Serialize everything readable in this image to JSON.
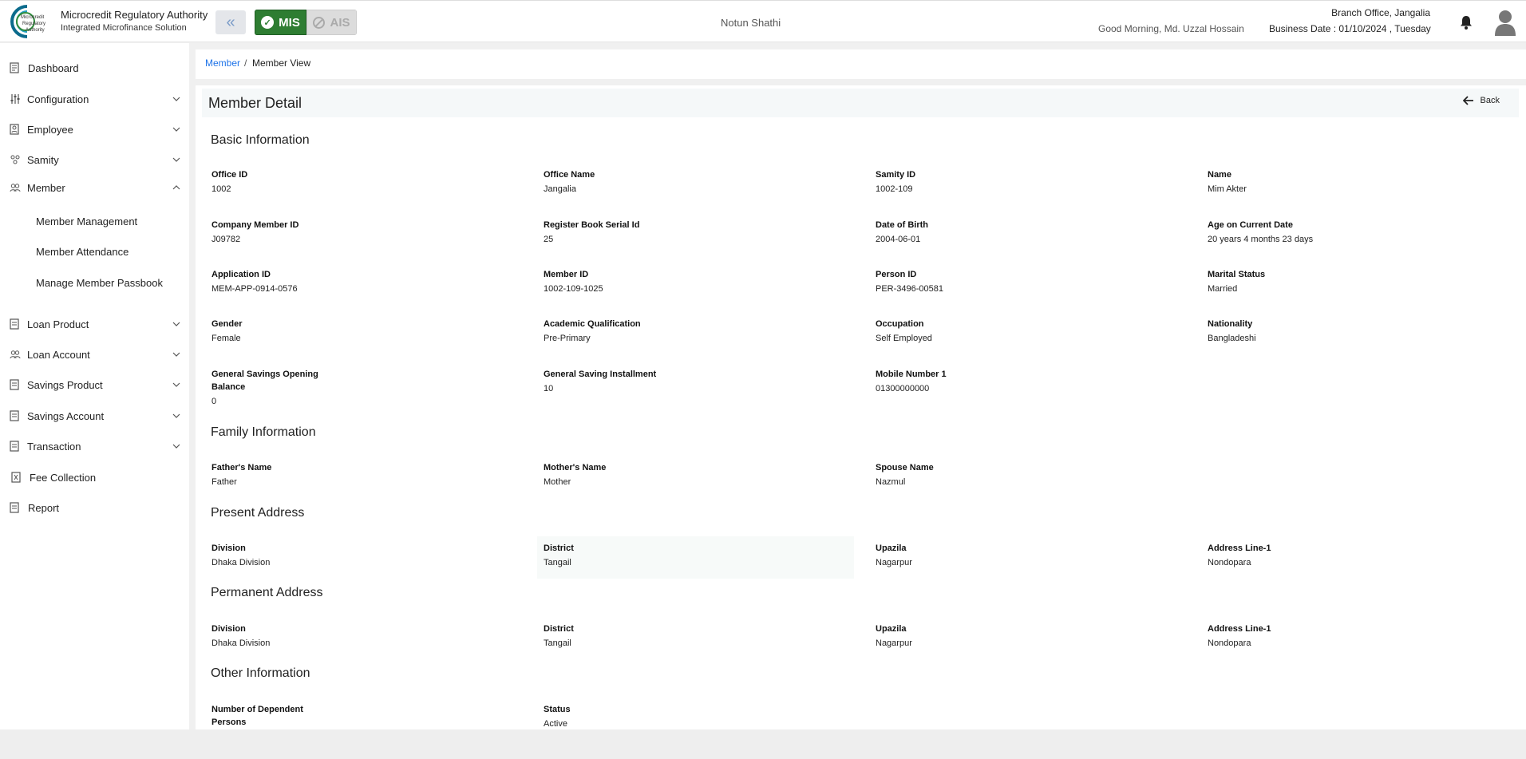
{
  "header": {
    "brand_title": "Microcredit Regulatory Authority",
    "brand_sub": "Integrated Microfinance Solution",
    "logo_text": "Microcredit Regulatory Authority",
    "mis_label": "MIS",
    "ais_label": "AIS",
    "center_title": "Notun Shathi",
    "greeting": "Good Morning, Md. Uzzal Hossain",
    "branch_office": "Branch Office, Jangalia",
    "business_date": "Business Date : 01/10/2024 , Tuesday"
  },
  "sidebar": {
    "items": [
      {
        "label": "Dashboard",
        "icon": "dashboard-icon"
      },
      {
        "label": "Configuration",
        "icon": "sliders-icon"
      },
      {
        "label": "Employee",
        "icon": "employee-icon"
      },
      {
        "label": "Samity",
        "icon": "samity-icon"
      },
      {
        "label": "Member",
        "icon": "members-icon"
      },
      {
        "label": "Loan Product",
        "icon": "loan-product-icon"
      },
      {
        "label": "Loan Account",
        "icon": "loan-account-icon"
      },
      {
        "label": "Savings Product",
        "icon": "savings-product-icon"
      },
      {
        "label": "Savings Account",
        "icon": "savings-account-icon"
      },
      {
        "label": "Transaction",
        "icon": "transaction-icon"
      },
      {
        "label": "Fee Collection",
        "icon": "fee-collection-icon"
      },
      {
        "label": "Report",
        "icon": "report-icon"
      }
    ],
    "member_sub": [
      "Member Management",
      "Member Attendance",
      "Manage Member Passbook"
    ]
  },
  "breadcrumb": {
    "parent": "Member",
    "separator": "/",
    "current": "Member View"
  },
  "page": {
    "title": "Member Detail",
    "back_label": "Back"
  },
  "sections": {
    "basic": {
      "title": "Basic Information",
      "fields": [
        {
          "label": "Office ID",
          "value": "1002"
        },
        {
          "label": "Office Name",
          "value": "Jangalia"
        },
        {
          "label": "Samity ID",
          "value": "1002-109"
        },
        {
          "label": "Name",
          "value": "Mim Akter"
        },
        {
          "label": "Company Member ID",
          "value": "J09782"
        },
        {
          "label": "Register Book Serial Id",
          "value": "25"
        },
        {
          "label": "Date of Birth",
          "value": "2004-06-01"
        },
        {
          "label": "Age on Current Date",
          "value": "20 years 4 months 23 days"
        },
        {
          "label": "Application ID",
          "value": "MEM-APP-0914-0576"
        },
        {
          "label": "Member ID",
          "value": "1002-109-1025"
        },
        {
          "label": "Person ID",
          "value": "PER-3496-00581"
        },
        {
          "label": "Marital Status",
          "value": "Married"
        },
        {
          "label": "Gender",
          "value": "Female"
        },
        {
          "label": "Academic Qualification",
          "value": "Pre-Primary"
        },
        {
          "label": "Occupation",
          "value": "Self Employed"
        },
        {
          "label": "Nationality",
          "value": "Bangladeshi"
        },
        {
          "label": "General Savings Opening Balance",
          "value": "0"
        },
        {
          "label": "General Saving Installment",
          "value": "10"
        },
        {
          "label": "Mobile Number 1",
          "value": "01300000000"
        }
      ]
    },
    "family": {
      "title": "Family Information",
      "fields": [
        {
          "label": "Father's Name",
          "value": "Father"
        },
        {
          "label": "Mother's Name",
          "value": "Mother"
        },
        {
          "label": "Spouse Name",
          "value": "Nazmul"
        }
      ]
    },
    "present": {
      "title": "Present Address",
      "fields": [
        {
          "label": "Division",
          "value": "Dhaka Division"
        },
        {
          "label": "District",
          "value": "Tangail"
        },
        {
          "label": "Upazila",
          "value": "Nagarpur"
        },
        {
          "label": "Address Line-1",
          "value": "Nondopara"
        }
      ]
    },
    "permanent": {
      "title": "Permanent Address",
      "fields": [
        {
          "label": "Division",
          "value": "Dhaka Division"
        },
        {
          "label": "District",
          "value": "Tangail"
        },
        {
          "label": "Upazila",
          "value": "Nagarpur"
        },
        {
          "label": "Address Line-1",
          "value": "Nondopara"
        }
      ]
    },
    "other": {
      "title": "Other Information",
      "fields": [
        {
          "label": "Number of Dependent Persons",
          "value": ""
        },
        {
          "label": "Status",
          "value": "Active"
        }
      ]
    }
  },
  "colors": {
    "accent_green": "#2e7d32",
    "link_blue": "#1e73e8"
  }
}
